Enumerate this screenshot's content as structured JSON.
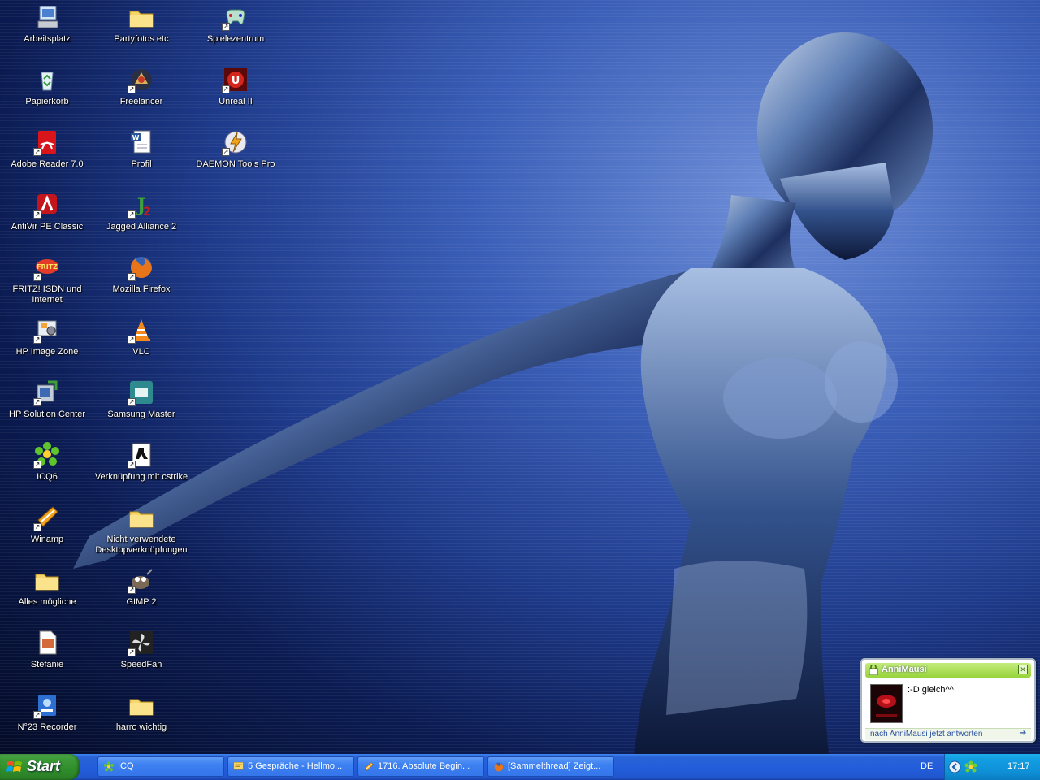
{
  "desktop": {
    "icons": [
      {
        "label": "Arbeitsplatz",
        "icon": "my-computer-icon",
        "shortcut": false
      },
      {
        "label": "Papierkorb",
        "icon": "recycle-bin-icon",
        "shortcut": false
      },
      {
        "label": "Adobe Reader 7.0",
        "icon": "adobe-reader-icon",
        "shortcut": true
      },
      {
        "label": "AntiVir PE Classic",
        "icon": "antivir-icon",
        "shortcut": true
      },
      {
        "label": "FRITZ! ISDN und Internet",
        "icon": "fritz-icon",
        "shortcut": true
      },
      {
        "label": "HP  Image Zone",
        "icon": "hp-image-zone-icon",
        "shortcut": true
      },
      {
        "label": "HP Solution Center",
        "icon": "hp-solution-center-icon",
        "shortcut": true
      },
      {
        "label": "ICQ6",
        "icon": "icq-flower-icon",
        "shortcut": true
      },
      {
        "label": "Winamp",
        "icon": "winamp-icon",
        "shortcut": true
      },
      {
        "label": "Alles mögliche",
        "icon": "folder-icon",
        "shortcut": false
      },
      {
        "label": "Stefanie",
        "icon": "image-file-icon",
        "shortcut": false
      },
      {
        "label": "N°23 Recorder",
        "icon": "recorder-icon",
        "shortcut": true
      },
      {
        "label": "Partyfotos etc",
        "icon": "folder-icon",
        "shortcut": false
      },
      {
        "label": "Freelancer",
        "icon": "freelancer-icon",
        "shortcut": true
      },
      {
        "label": "Profil",
        "icon": "word-document-icon",
        "shortcut": false
      },
      {
        "label": "Jagged Alliance 2",
        "icon": "jagged-alliance-icon",
        "shortcut": true
      },
      {
        "label": "Mozilla Firefox",
        "icon": "firefox-icon",
        "shortcut": true
      },
      {
        "label": "VLC",
        "icon": "vlc-cone-icon",
        "shortcut": true
      },
      {
        "label": "Samsung Master",
        "icon": "samsung-master-icon",
        "shortcut": true
      },
      {
        "label": "Verknüpfung mit cstrike",
        "icon": "counter-strike-icon",
        "shortcut": true
      },
      {
        "label": "Nicht verwendete Desktopverknüpfungen",
        "icon": "folder-icon",
        "shortcut": false
      },
      {
        "label": "GIMP 2",
        "icon": "gimp-icon",
        "shortcut": true
      },
      {
        "label": "SpeedFan",
        "icon": "speedfan-icon",
        "shortcut": true
      },
      {
        "label": "harro wichtig",
        "icon": "folder-icon",
        "shortcut": false
      },
      {
        "label": "Spielezentrum",
        "icon": "game-controller-icon",
        "shortcut": true
      },
      {
        "label": "Unreal II",
        "icon": "unreal-icon",
        "shortcut": true
      },
      {
        "label": "DAEMON Tools Pro",
        "icon": "daemon-tools-icon",
        "shortcut": true
      }
    ]
  },
  "taskbar": {
    "start_label": "Start",
    "tasks": [
      {
        "label": "ICQ",
        "icon": "icq-flower-icon",
        "active": false
      },
      {
        "label": "5 Gespräche - Hellmo...",
        "icon": "chat-window-icon",
        "active": false
      },
      {
        "label": "1716. Absolute Begin...",
        "icon": "winamp-icon",
        "active": false
      },
      {
        "label": "[Sammelthread] Zeigt...",
        "icon": "firefox-icon",
        "active": false
      }
    ],
    "language": "DE",
    "clock": "17:17"
  },
  "notification": {
    "title": "AnniMausi",
    "message": ":-D  gleich^^",
    "reply_link": "nach AnniMausi jetzt antworten",
    "close_glyph": "✕",
    "arrow_glyph": "➔"
  },
  "colors": {
    "taskbar_blue": "#245edb",
    "start_green": "#3c9b37",
    "tray_blue": "#0f8fd6",
    "popup_green": "#97d43a"
  }
}
